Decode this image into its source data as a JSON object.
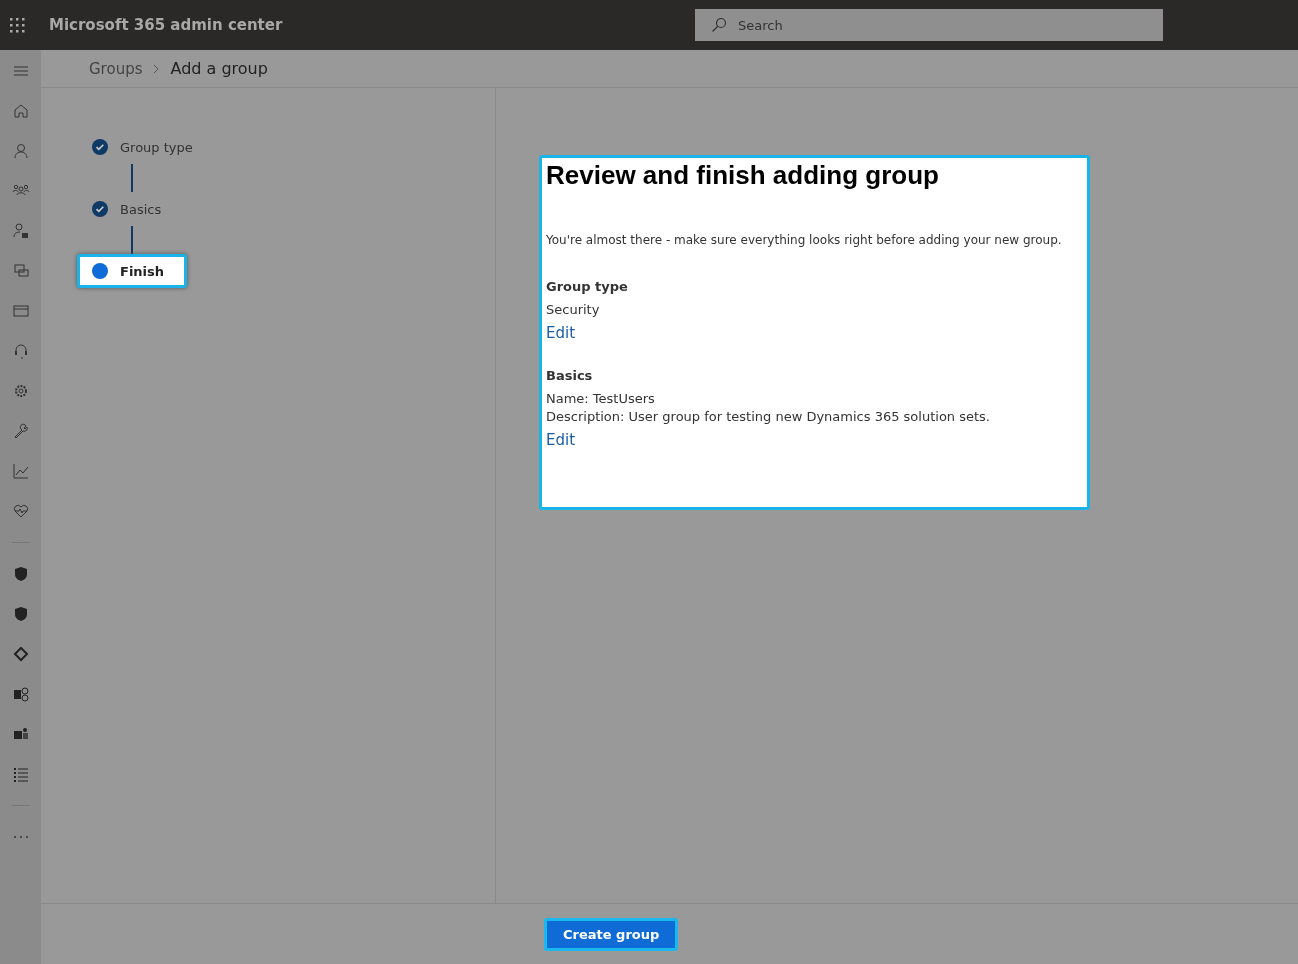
{
  "header": {
    "app_title": "Microsoft 365 admin center",
    "search": {
      "placeholder": "Search"
    }
  },
  "breadcrumb": [
    {
      "label": "Groups",
      "current": false
    },
    {
      "label": "Add a group",
      "current": true
    }
  ],
  "steps": [
    {
      "label": "Group type",
      "completed": true,
      "selected": false
    },
    {
      "label": "Basics",
      "completed": true,
      "selected": false
    },
    {
      "label": "Finish",
      "completed": false,
      "selected": true
    }
  ],
  "review": {
    "title": "Review and finish adding group",
    "intro": "You're almost there - make sure everything looks right before adding your new group.",
    "sections": [
      {
        "heading": "Group type",
        "lines": [
          "Security"
        ],
        "edit_link": "Edit"
      },
      {
        "heading": "Basics",
        "lines": [
          "Name: TestUsers",
          "Description: User group for testing new Dynamics 365 solution sets."
        ],
        "edit_link": "Edit"
      }
    ]
  },
  "footer": {
    "primary_button": "Create group"
  }
}
